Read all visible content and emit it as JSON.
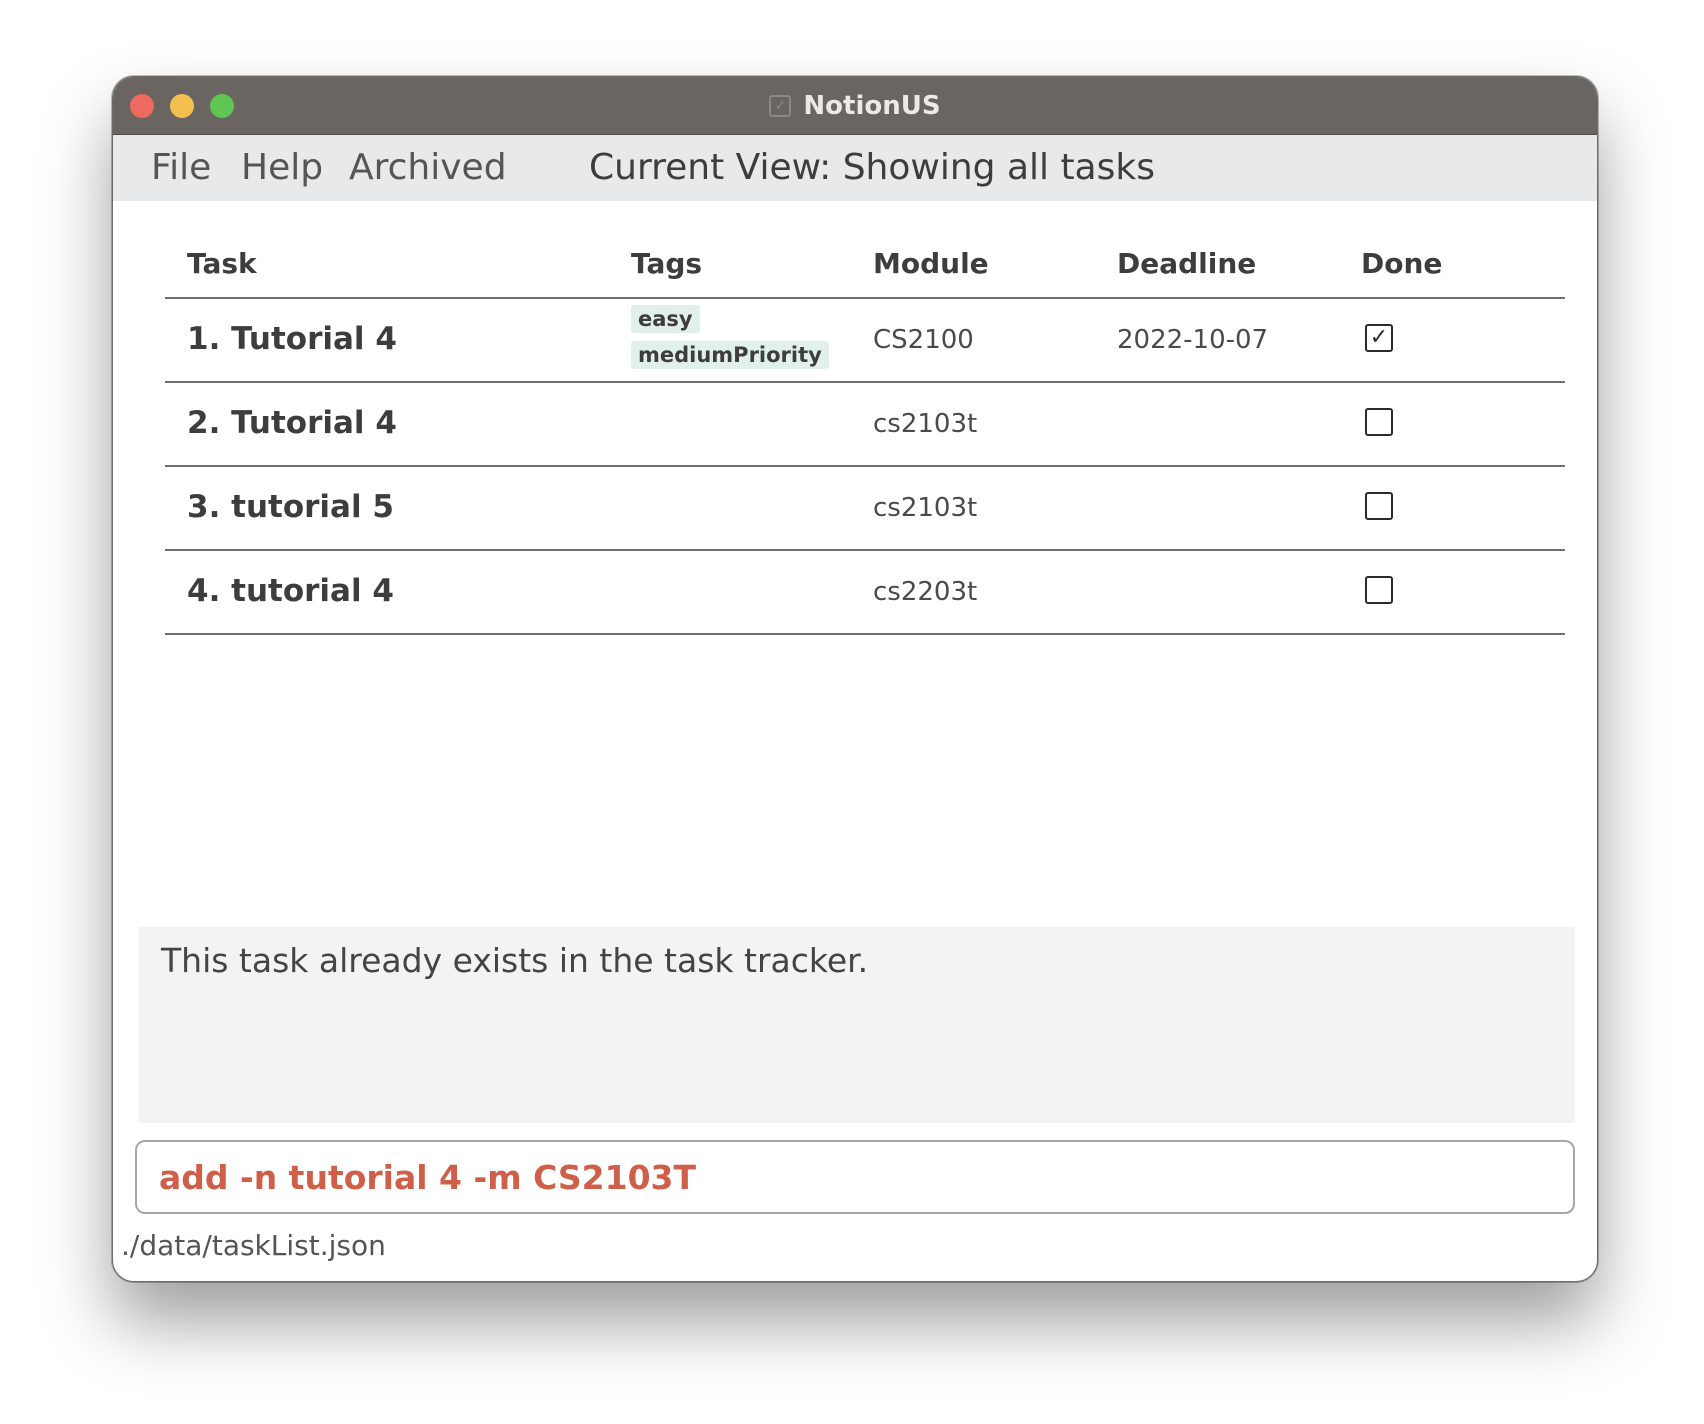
{
  "window": {
    "title": "NotionUS",
    "app_icon": "checkbox-app-icon",
    "traffic_lights": {
      "close": "#ed6a5e",
      "minimize": "#f4bf4f",
      "maximize": "#61c554"
    }
  },
  "menu": {
    "file": "File",
    "help": "Help",
    "archived": "Archived",
    "current_view": "Current View: Showing all tasks"
  },
  "table": {
    "headers": {
      "task": "Task",
      "tags": "Tags",
      "module": "Module",
      "deadline": "Deadline",
      "done": "Done"
    },
    "rows": [
      {
        "task": "1. Tutorial 4",
        "tags": [
          "easy",
          "mediumPriority"
        ],
        "module": "CS2100",
        "deadline": "2022-10-07",
        "done": true
      },
      {
        "task": "2. Tutorial 4",
        "tags": [],
        "module": "cs2103t",
        "deadline": "",
        "done": false
      },
      {
        "task": "3. tutorial 5",
        "tags": [],
        "module": "cs2103t",
        "deadline": "",
        "done": false
      },
      {
        "task": "4. tutorial 4",
        "tags": [],
        "module": "cs2203t",
        "deadline": "",
        "done": false
      }
    ]
  },
  "result": {
    "message": "This task already exists in the task tracker."
  },
  "command": {
    "value": "add -n tutorial 4 -m CS2103T"
  },
  "status": {
    "path": "./data/taskList.json"
  },
  "colors": {
    "titlebar": "#6a6560",
    "menubar": "#e8e9eb",
    "tag_bg": "#e2f0ec",
    "command_text": "#d05f4a"
  }
}
